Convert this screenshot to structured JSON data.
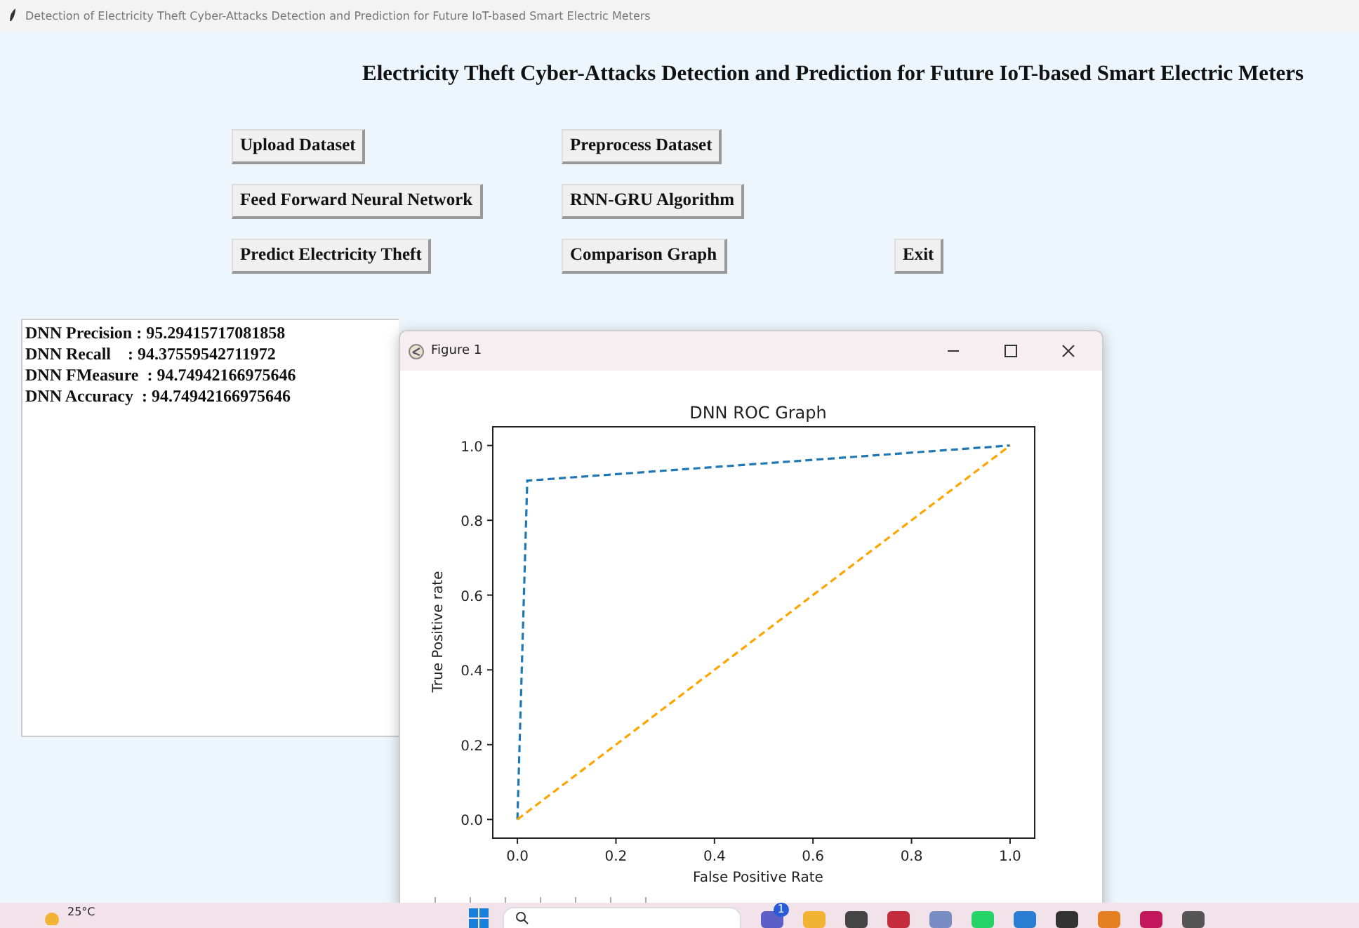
{
  "window": {
    "title": "Detection of Electricity Theft Cyber-Attacks Detection and Prediction for Future IoT-based Smart Electric Meters"
  },
  "heading": "Electricity Theft Cyber-Attacks Detection and Prediction for Future IoT-based Smart Electric Meters",
  "buttons": [
    "Upload Dataset",
    "Preprocess Dataset",
    "Feed Forward Neural Network",
    "RNN-GRU Algorithm",
    "Predict Electricity Theft",
    "Comparison Graph",
    "Exit"
  ],
  "output": [
    "DNN Precision : 95.29415717081858",
    "DNN Recall    : 94.37559542711972",
    "DNN FMeasure  : 94.74942166975646",
    "DNN Accuracy  : 94.74942166975646"
  ],
  "figure": {
    "title": "Figure 1",
    "chart_data": {
      "type": "line",
      "title": "DNN ROC Graph",
      "xlabel": "False Positive Rate",
      "ylabel": "True Positive rate",
      "x": [
        0,
        0.02,
        1
      ],
      "series": [
        {
          "color": "#1f77b4",
          "line_style": "dashed",
          "values": [
            0,
            0.906,
            1
          ]
        },
        {
          "color": "#ffa500",
          "line_style": "dashed",
          "values": [
            0,
            null,
            1
          ]
        }
      ],
      "xlim": [
        -0.05,
        1.05
      ],
      "ylim": [
        -0.05,
        1.05
      ],
      "xticks": [
        {
          "value": 0,
          "label": "0.0"
        },
        {
          "value": 0.2,
          "label": "0.2"
        },
        {
          "value": 0.4,
          "label": "0.4"
        },
        {
          "value": 0.6,
          "label": "0.6"
        },
        {
          "value": 0.8,
          "label": "0.8"
        },
        {
          "value": 1,
          "label": "1.0"
        }
      ],
      "yticks": [
        {
          "value": 0,
          "label": "0.0"
        },
        {
          "value": 0.2,
          "label": "0.2"
        },
        {
          "value": 0.4,
          "label": "0.4"
        },
        {
          "value": 0.6,
          "label": "0.6"
        },
        {
          "value": 0.8,
          "label": "0.8"
        },
        {
          "value": 1,
          "label": "1.0"
        }
      ]
    }
  },
  "taskbar": {
    "weather": "25°C",
    "badges": [
      "1"
    ]
  }
}
